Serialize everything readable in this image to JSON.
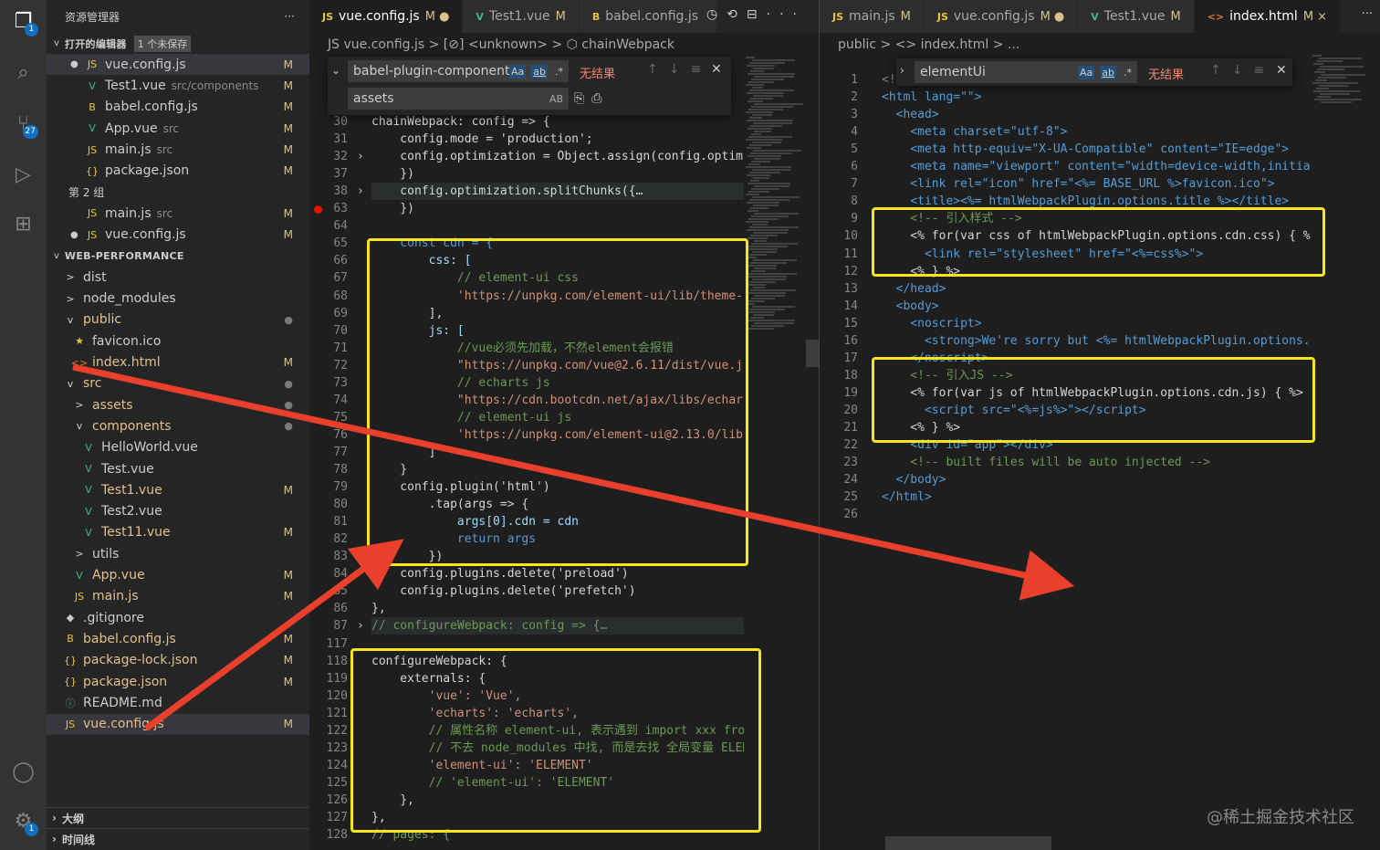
{
  "activity": {
    "explorer_badge": "1",
    "scm_badge": "27",
    "settings_badge": "1"
  },
  "sidebar": {
    "title": "资源管理器",
    "open_editors_label": "打开的编辑器",
    "unsaved_label": "1 个未保存",
    "group2_label": "第 2 组",
    "project_label": "WEB-PERFORMANCE",
    "outline_label": "大纲",
    "timeline_label": "时间线",
    "open_editors": [
      {
        "icon": "JS",
        "name": "vue.config.js",
        "path": "",
        "status": "M"
      },
      {
        "icon": "V",
        "name": "Test1.vue",
        "path": "src/components",
        "status": "M"
      },
      {
        "icon": "B",
        "name": "babel.config.js",
        "path": "",
        "status": "M"
      },
      {
        "icon": "V",
        "name": "App.vue",
        "path": "src",
        "status": "M"
      },
      {
        "icon": "JS",
        "name": "main.js",
        "path": "src",
        "status": "M"
      },
      {
        "icon": "{}",
        "name": "package.json",
        "path": "",
        "status": "M"
      }
    ],
    "group2": [
      {
        "icon": "JS",
        "name": "main.js",
        "path": "src",
        "status": "M"
      },
      {
        "icon": "JS",
        "name": "vue.config.js",
        "path": "",
        "status": "M"
      }
    ],
    "tree": [
      {
        "indent": 1,
        "icon": ">",
        "name": "dist",
        "status": ""
      },
      {
        "indent": 1,
        "icon": ">",
        "name": "node_modules",
        "status": ""
      },
      {
        "indent": 1,
        "icon": "v",
        "name": "public",
        "status": "dot"
      },
      {
        "indent": 2,
        "icon": "★",
        "name": "favicon.ico",
        "status": ""
      },
      {
        "indent": 2,
        "icon": "<>",
        "name": "index.html",
        "status": "M"
      },
      {
        "indent": 1,
        "icon": "v",
        "name": "src",
        "status": "dot"
      },
      {
        "indent": 2,
        "icon": ">",
        "name": "assets",
        "status": "dot"
      },
      {
        "indent": 2,
        "icon": "v",
        "name": "components",
        "status": "dot"
      },
      {
        "indent": 3,
        "icon": "V",
        "name": "HelloWorld.vue",
        "status": ""
      },
      {
        "indent": 3,
        "icon": "V",
        "name": "Test.vue",
        "status": ""
      },
      {
        "indent": 3,
        "icon": "V",
        "name": "Test1.vue",
        "status": "M"
      },
      {
        "indent": 3,
        "icon": "V",
        "name": "Test2.vue",
        "status": ""
      },
      {
        "indent": 3,
        "icon": "V",
        "name": "Test11.vue",
        "status": "M"
      },
      {
        "indent": 2,
        "icon": ">",
        "name": "utils",
        "status": ""
      },
      {
        "indent": 2,
        "icon": "V",
        "name": "App.vue",
        "status": "M"
      },
      {
        "indent": 2,
        "icon": "JS",
        "name": "main.js",
        "status": "M"
      },
      {
        "indent": 1,
        "icon": "◆",
        "name": ".gitignore",
        "status": ""
      },
      {
        "indent": 1,
        "icon": "B",
        "name": "babel.config.js",
        "status": "M"
      },
      {
        "indent": 1,
        "icon": "{}",
        "name": "package-lock.json",
        "status": "M"
      },
      {
        "indent": 1,
        "icon": "{}",
        "name": "package.json",
        "status": "M"
      },
      {
        "indent": 1,
        "icon": "ⓘ",
        "name": "README.md",
        "status": ""
      },
      {
        "indent": 1,
        "icon": "JS",
        "name": "vue.config.js",
        "status": "M"
      }
    ]
  },
  "editor1": {
    "tabs": [
      {
        "icon": "JS",
        "label": "vue.config.js",
        "mark": "M ●"
      },
      {
        "icon": "V",
        "label": "Test1.vue",
        "mark": "M"
      },
      {
        "icon": "B",
        "label": "babel.config.js",
        "mark": ""
      }
    ],
    "breadcrumb": "JS vue.config.js > [⊘] <unknown> > ⬡ chainWebpack",
    "find_value": "babel-plugin-component",
    "replace_value": "assets",
    "no_results": "无结果",
    "case_label": "Aa",
    "word_label": "ab",
    "regex_label": ".*",
    "preserve_label": "AB"
  },
  "editor2": {
    "tabs": [
      {
        "icon": "JS",
        "label": "main.js",
        "mark": "M"
      },
      {
        "icon": "JS",
        "label": "vue.config.js",
        "mark": "M ●"
      },
      {
        "icon": "V",
        "label": "Test1.vue",
        "mark": "M"
      },
      {
        "icon": "<>",
        "label": "index.html",
        "mark": "M ×"
      }
    ],
    "breadcrumb": "public > <> index.html > ...",
    "find_value": "elementUi",
    "no_results": "无结果"
  },
  "watermark": "@稀土掘金技术社区"
}
